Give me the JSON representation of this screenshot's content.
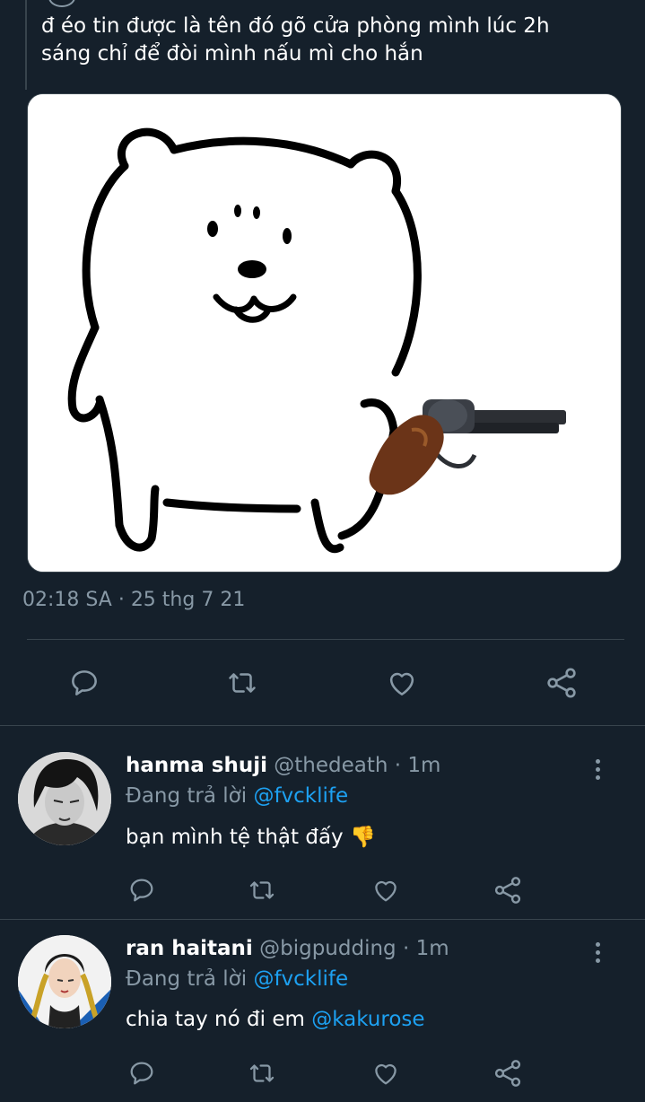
{
  "tweet": {
    "text_line1": "đ éo tin được là tên đó gõ cửa phòng mình lúc 2h",
    "text_line2": "sáng chỉ để đòi mình nấu mì cho hắn",
    "time": "02:18 SA",
    "separator": " · ",
    "date": "25 thg 7 21"
  },
  "replies": [
    {
      "name": "hanma shuji",
      "handle": "@thedeath",
      "age": "1m",
      "replying_label": "Đang trả lời",
      "replying_to": "@fvcklife",
      "text": "bạn mình tệ thật đấy",
      "emoji": "👎",
      "mention": ""
    },
    {
      "name": "ran haitani",
      "handle": "@bigpudding",
      "age": "1m",
      "replying_label": "Đang trả lời",
      "replying_to": "@fvcklife",
      "text": "chia tay nó đi em",
      "emoji": "",
      "mention": "@kakurose"
    }
  ],
  "icons": {
    "reply": "comment-icon",
    "retweet": "retweet-icon",
    "like": "heart-icon",
    "share": "share-icon",
    "more": "more-vertical-icon"
  },
  "colors": {
    "background": "#15202b",
    "muted": "#8899a6",
    "link": "#1da1f2",
    "divider": "#38444d"
  }
}
